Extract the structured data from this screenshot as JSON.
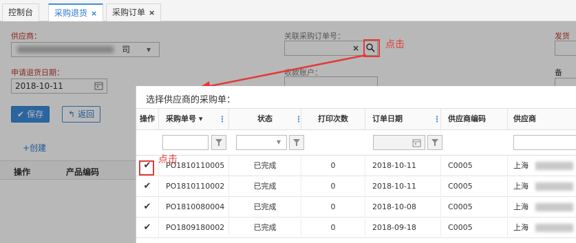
{
  "tabs": [
    {
      "label": "控制台",
      "closable": false,
      "active": false
    },
    {
      "label": "采购退货",
      "closable": true,
      "active": true
    },
    {
      "label": "采购订单",
      "closable": true,
      "active": false
    }
  ],
  "form": {
    "supplier_label": "供应商：",
    "supplier_value_suffix": "司",
    "return_date_label": "申请退货日期：",
    "return_date_value": "2018-10-11",
    "related_order_label": "关联采购订单号：",
    "receive_account_label": "收款账户：",
    "ship_label": "发货仓",
    "remark_label": "备注：",
    "save_label": "保存",
    "back_label": "返回",
    "create_label": "+创建",
    "grid_columns": [
      "操作",
      "产品编码"
    ]
  },
  "annotations": {
    "click_text_1": "点击",
    "click_text_2": "点击",
    "highlight_color": "#e53935"
  },
  "dialog": {
    "title": "选择供应商的采购单：",
    "columns": [
      "操作",
      "采购单号 ▾",
      "状态",
      "打印次数",
      "订单日期",
      "供应商编码",
      "供应商"
    ],
    "rows": [
      {
        "order_no": "PO1810110005",
        "status": "已完成",
        "print_count": "0",
        "order_date": "2018-10-11",
        "supplier_code": "C0005",
        "supplier": "上海"
      },
      {
        "order_no": "PO1810110002",
        "status": "已完成",
        "print_count": "0",
        "order_date": "2018-10-11",
        "supplier_code": "C0005",
        "supplier": "上海"
      },
      {
        "order_no": "PO1810080004",
        "status": "已完成",
        "print_count": "0",
        "order_date": "2018-10-08",
        "supplier_code": "C0005",
        "supplier": "上海"
      },
      {
        "order_no": "PO1809180002",
        "status": "已完成",
        "print_count": "0",
        "order_date": "2018-09-18",
        "supplier_code": "C0005",
        "supplier": "上海"
      }
    ]
  },
  "icons": {
    "close": "×",
    "search": "search-icon",
    "calendar": "calendar-icon",
    "filter": "filter-icon",
    "check": "✔",
    "caret": "▾",
    "column_menu": "⋮",
    "back": "↰"
  },
  "colors": {
    "accent": "#3c8dde",
    "required_label": "#c0392b"
  }
}
